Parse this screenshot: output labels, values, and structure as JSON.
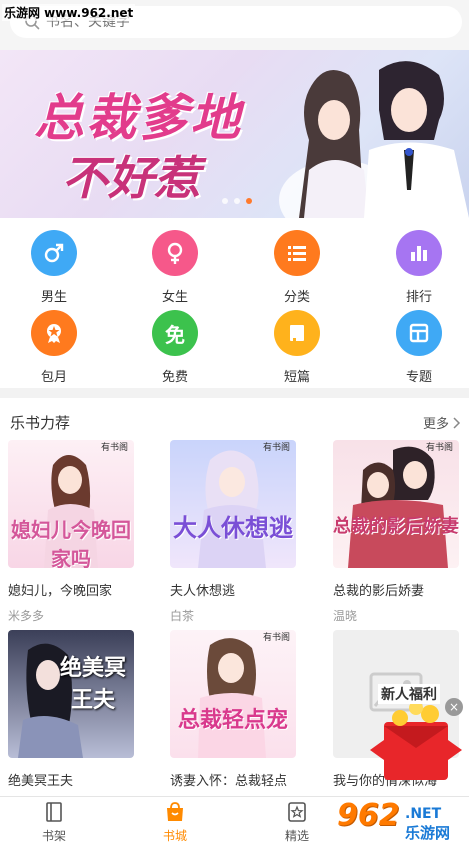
{
  "watermark": "乐游网 www.962.net",
  "search": {
    "placeholder": "书名、关键字"
  },
  "banner": {
    "title_line1": "总裁爹地",
    "title_line2": "不好惹",
    "dots": 3,
    "active_dot": 2
  },
  "categories": [
    {
      "label": "男生",
      "icon": "male-icon",
      "color": "#3fa9f5"
    },
    {
      "label": "女生",
      "icon": "female-icon",
      "color": "#f6588a"
    },
    {
      "label": "分类",
      "icon": "list-icon",
      "color": "#ff7a1e"
    },
    {
      "label": "排行",
      "icon": "bar-chart-icon",
      "color": "#a675f2"
    },
    {
      "label": "包月",
      "icon": "medal-icon",
      "color": "#ff7a1e"
    },
    {
      "label": "免费",
      "icon": "free-icon",
      "glyph": "免",
      "color": "#3cc24d"
    },
    {
      "label": "短篇",
      "icon": "book-icon",
      "color": "#ffb21c"
    },
    {
      "label": "专题",
      "icon": "topic-icon",
      "color": "#3fa9f5"
    }
  ],
  "section": {
    "title": "乐书力荐",
    "more": "更多"
  },
  "books": [
    {
      "name": "媳妇儿，今晚回家",
      "author": "米多多",
      "cover_text": "媳妇儿今晚回家吗",
      "cover_bg": "#fbe4ee",
      "cover_color": "#d4579a",
      "pub": "有书阁"
    },
    {
      "name": "夫人休想逃",
      "author": "白茶",
      "cover_text": "大人休想逃",
      "cover_bg": "#d9e3fb",
      "cover_color": "#7a4fd6",
      "pub": "有书阁"
    },
    {
      "name": "总裁的影后娇妻",
      "author": "温晓",
      "cover_text": "总裁的影后娇妻",
      "cover_bg": "#fbe7ec",
      "cover_color": "#c83b6e",
      "pub": "有书阁"
    },
    {
      "name": "绝美冥王夫",
      "author": "",
      "cover_text": "绝美冥王夫",
      "cover_bg": "#ccd2e6",
      "cover_color": "#ffffff",
      "pub": ""
    },
    {
      "name": "诱妻入怀：总裁轻点",
      "author": "",
      "cover_text": "总裁轻点宠",
      "cover_bg": "#fde5f1",
      "cover_color": "#d93a8d",
      "pub": "有书阁"
    },
    {
      "name": "我与你的情深似海",
      "author": "",
      "cover_text": "",
      "cover_bg": "#eeeeee",
      "cover_color": "#999999",
      "pub": ""
    }
  ],
  "promo": {
    "text": "新人福利",
    "close": "×"
  },
  "tabs": [
    {
      "label": "书架",
      "icon": "bookshelf-icon",
      "active": false
    },
    {
      "label": "书城",
      "icon": "store-icon",
      "active": true
    },
    {
      "label": "精选",
      "icon": "star-icon",
      "active": false
    }
  ],
  "site_logo": {
    "big": "962",
    "domain": ".NET",
    "name": "乐游网"
  }
}
